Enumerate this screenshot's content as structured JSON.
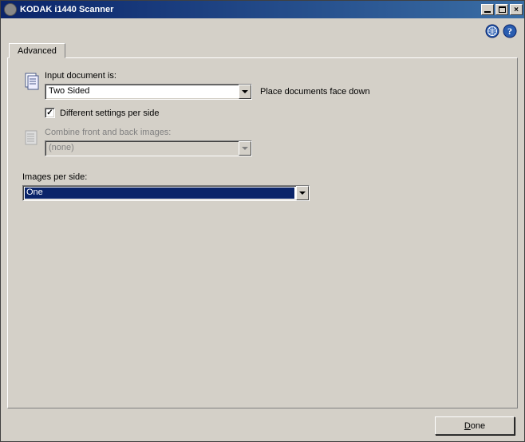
{
  "window": {
    "title": "KODAK i1440 Scanner"
  },
  "tabs": {
    "advanced": "Advanced"
  },
  "fields": {
    "input_document": {
      "label": "Input document is:",
      "value": "Two Sided",
      "hint": "Place documents face down"
    },
    "diff_settings": {
      "label": "Different settings per side",
      "checked": true
    },
    "combine": {
      "label": "Combine front and back images:",
      "value": "(none)"
    },
    "images_per_side": {
      "label": "Images per side:",
      "value": "One"
    }
  },
  "buttons": {
    "done": "Done",
    "done_mnemonic": "D"
  }
}
